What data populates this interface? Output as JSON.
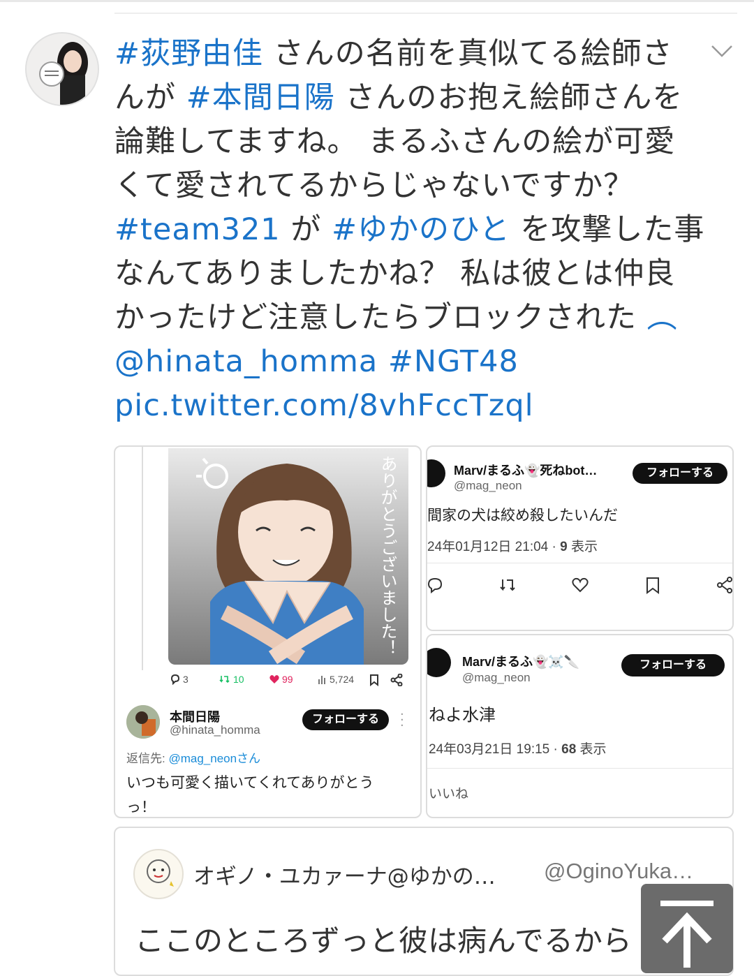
{
  "tweet": {
    "lines": [
      [
        {
          "t": "#荻野由佳",
          "tag": true
        },
        {
          "t": " さんの名前を真似てる絵師さ",
          "tag": false
        }
      ],
      [
        {
          "t": "んが ",
          "tag": false
        },
        {
          "t": "#本間日陽",
          "tag": true
        },
        {
          "t": " さんのお抱え絵師さんを",
          "tag": false
        }
      ],
      [
        {
          "t": "論難してますね。 まるふさんの絵が可愛",
          "tag": false
        }
      ],
      [
        {
          "t": "くて愛されてるからじゃないですか？",
          "tag": false
        }
      ],
      [
        {
          "t": "#team321",
          "tag": true
        },
        {
          "t": " が ",
          "tag": false
        },
        {
          "t": "#ゆかのひと",
          "tag": true
        },
        {
          "t": " を攻撃した事",
          "tag": false
        }
      ],
      [
        {
          "t": "なんてありましたかね？ 私は彼とは仲良",
          "tag": false
        }
      ],
      [
        {
          "t": "かったけど注意したらブロックされた",
          "tag": false
        },
        {
          "t": " ︵",
          "tag": true
        }
      ],
      [
        {
          "t": "@hinata_homma #NGT48",
          "tag": true
        }
      ],
      [
        {
          "t": "pic.twitter.com/8vhFccTzql",
          "tag": true
        }
      ]
    ]
  },
  "left_card": {
    "illustration_text": "ありがとうございました！",
    "stats": {
      "replies": "3",
      "retweets": "10",
      "likes": "99",
      "views": "5,724"
    },
    "author_name": "本間日陽",
    "author_handle": "@hinata_homma",
    "follow_label": "フォローする",
    "reply_to_prefix": "返信先: ",
    "reply_to_handle": "@mag_neonさん",
    "text_line1": "いつも可愛く描いてくれてありがとう",
    "text_line2": "っ！"
  },
  "right_top_card": {
    "author_name": "Marv/まるふ👻死ねbot…",
    "author_handle": "@mag_neon",
    "follow_label": "フォローする",
    "text": "間家の犬は絞め殺したいんだ",
    "date": "24年01月12日 21:04 · ",
    "views_count": "9",
    "views_label": " 表示"
  },
  "right_bottom_card": {
    "author_name": "Marv/まるふ👻☠️🔪",
    "author_handle": "@mag_neon",
    "follow_label": "フォローする",
    "text": "ねよ水津",
    "date": "24年03月21日 19:15 · ",
    "views_count": "68",
    "views_label": " 表示",
    "footer": "いいね"
  },
  "quote": {
    "author_name": "オギノ・ユカァーナ@ゆかの…",
    "author_handle": "@OginoYuka…",
    "text": "ここのところずっと彼は病んでるから"
  },
  "colors": {
    "link": "#1a73c9",
    "text": "#333333",
    "retweet": "#17bf63",
    "like": "#e0245e"
  }
}
